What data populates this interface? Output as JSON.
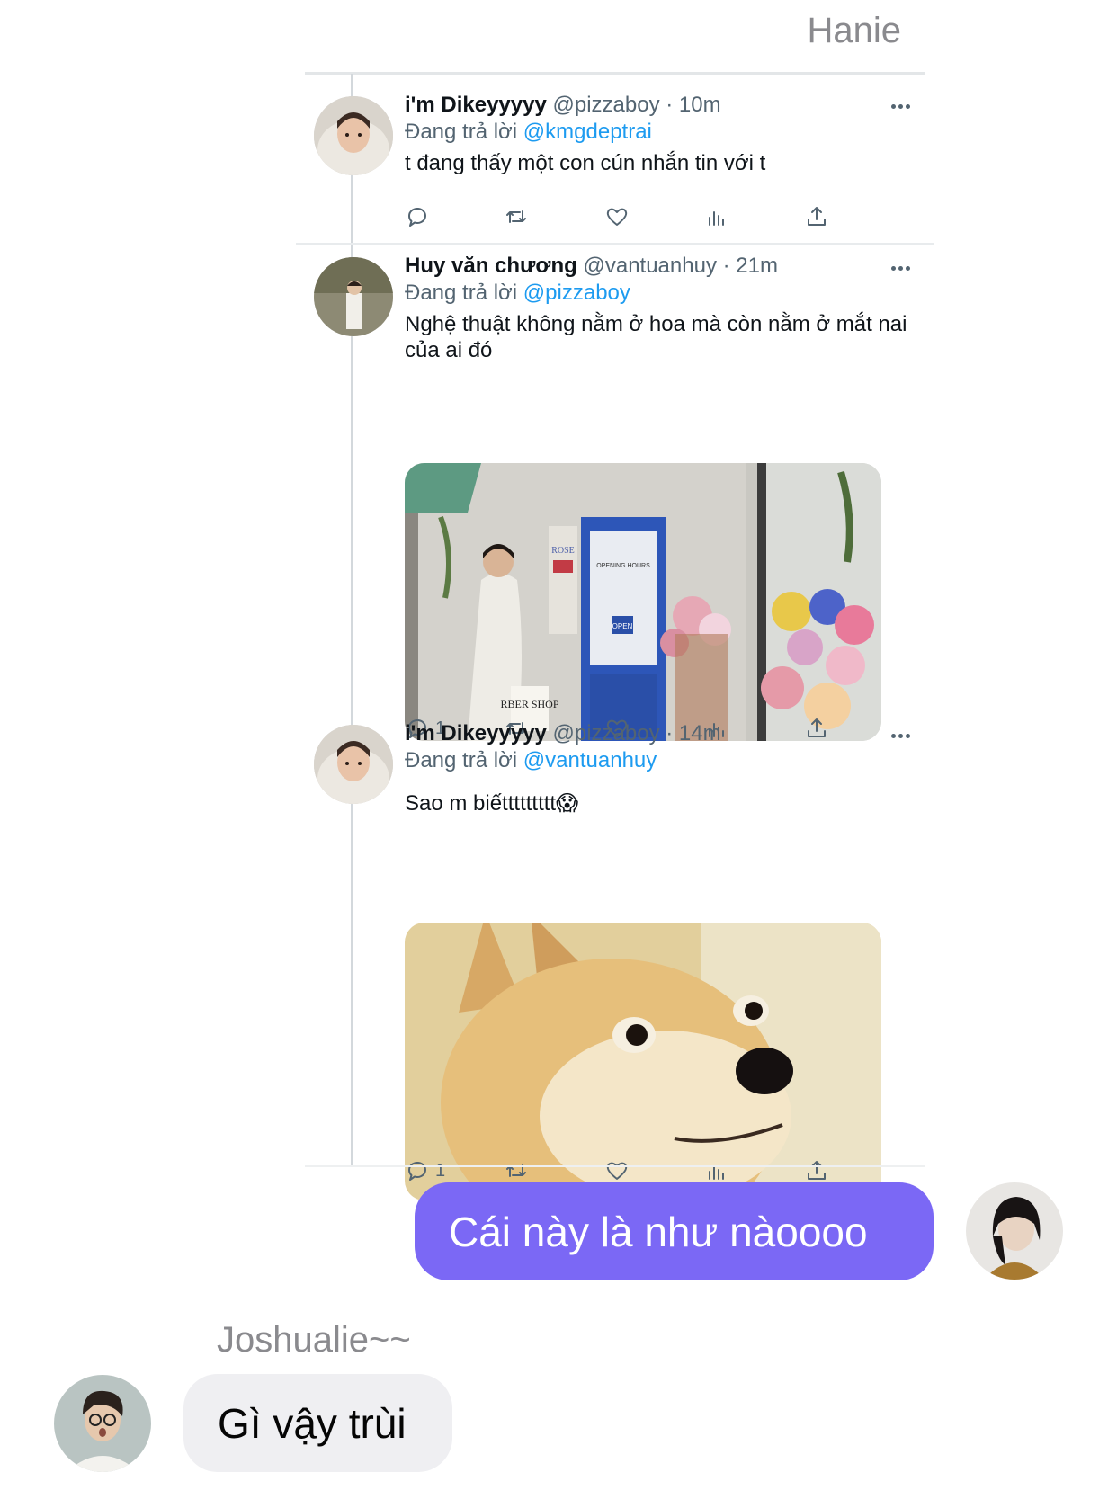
{
  "chat": {
    "sender_top": "Hanie",
    "sender_bottom": "Joshualie~~",
    "my_message": "Cái này là như nàoooo",
    "their_message": "Gì vậy trùi",
    "bubble_color": "#7b68f5"
  },
  "thread": {
    "tweets": [
      {
        "display_name": "i'm Dikeyyyyy",
        "handle": "@pizzaboy",
        "time": "· 10m",
        "replying_prefix": "Đang trả lời",
        "replying_to": "@kmgdeptrai",
        "text": "t đang thấy một con cún nhắn tin với t",
        "reply_count": "",
        "has_media": false
      },
      {
        "display_name": "Huy văn chương",
        "handle": "@vantuanhuy",
        "time": "· 21m",
        "replying_prefix": "Đang trả lời",
        "replying_to": "@pizzaboy",
        "text": "Nghệ thuật không nằm ở hoa mà còn nằm ở mắt nai của ai đó",
        "reply_count": "1",
        "has_media": true,
        "media": {
          "sign_rose": "ROSE",
          "sign_hours": "OPENING HOURS",
          "sign_open": "OPEN",
          "sign_barber": "RBER SHOP"
        }
      },
      {
        "display_name": "i'm Dikeyyyyy",
        "handle": "@pizzaboy",
        "time": "· 14m",
        "replying_prefix": "Đang trả lời",
        "replying_to": "@vantuanhuy",
        "text": "Sao m biếttttttttt😱",
        "reply_count": "1",
        "has_media": true
      }
    ],
    "icons": [
      "reply-icon",
      "retweet-icon",
      "like-icon",
      "views-icon",
      "share-icon"
    ],
    "accent_color": "#1d9bf0"
  }
}
